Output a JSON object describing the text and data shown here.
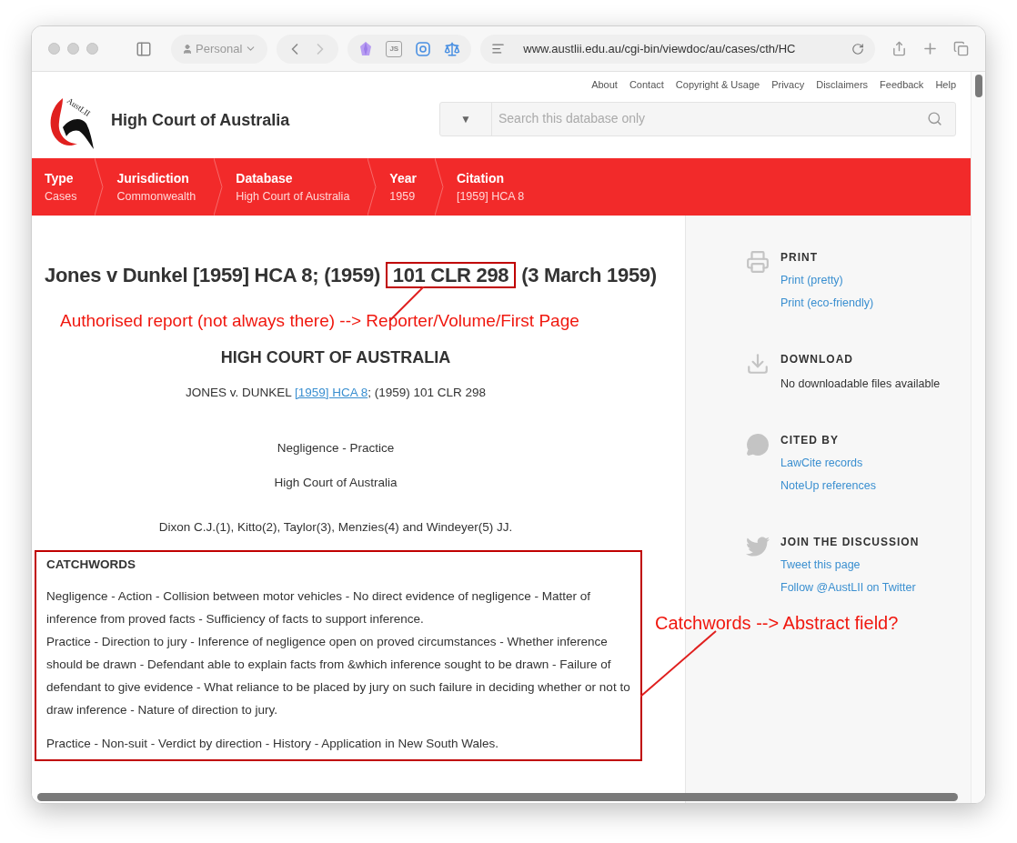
{
  "browser": {
    "profile": "Personal",
    "js_extension": "JS",
    "url": "www.austlii.edu.au/cgi-bin/viewdoc/au/cases/cth/HC"
  },
  "header": {
    "logo_text": "AustLII",
    "site_title": "High Court of Australia",
    "top_links": [
      "About",
      "Contact",
      "Copyright & Usage",
      "Privacy",
      "Disclaimers",
      "Feedback",
      "Help"
    ],
    "search": {
      "scope_arrow": "▼",
      "placeholder": "Search this database only"
    }
  },
  "breadcrumbs": [
    {
      "label": "Type",
      "value": "Cases"
    },
    {
      "label": "Jurisdiction",
      "value": "Commonwealth"
    },
    {
      "label": "Database",
      "value": "High Court of Australia"
    },
    {
      "label": "Year",
      "value": "1959"
    },
    {
      "label": "Citation",
      "value": "[1959] HCA 8"
    }
  ],
  "document": {
    "title": {
      "before": "Jones v Dunkel [1959] HCA 8; (1959)",
      "highlighted": "101 CLR 298",
      "after": "(3 March 1959)"
    },
    "title_annotation": "Authorised report (not always there) --> Reporter/Volume/First Page",
    "court_heading": "HIGH COURT OF AUSTRALIA",
    "citation": {
      "before": "JONES v. DUNKEL ",
      "link": "[1959] HCA 8",
      "after": "; (1959) 101 CLR 298"
    },
    "subject": "Negligence - Practice",
    "court": "High Court of Australia",
    "judges": "Dixon C.J.(1), Kitto(2), Taylor(3), Menzies(4) and Windeyer(5) JJ.",
    "catchwords": {
      "heading": "CATCHWORDS",
      "annotation": "Catchwords --> Abstract field?",
      "paragraphs": [
        {
          "lines": [
            "Negligence - Action - Collision between motor vehicles - No direct evidence of negligence - Matter of inference from proved facts - Sufficiency of facts to support inference.",
            "Practice - Direction to jury - Inference of negligence open on proved circumstances - Whether inference should be drawn - Defendant able to explain facts from &which inference sought to be drawn - Failure of defendant to give evidence - What reliance to be placed by jury on such failure in deciding whether or not to draw inference - Nature of direction to jury."
          ]
        },
        {
          "lines": [
            "Practice - Non-suit - Verdict by direction - History - Application in New South Wales."
          ]
        }
      ]
    }
  },
  "sidebar": [
    {
      "heading": "PRINT",
      "items": [
        {
          "kind": "link",
          "text": "Print (pretty)"
        },
        {
          "kind": "link",
          "text": "Print (eco-friendly)"
        }
      ]
    },
    {
      "heading": "DOWNLOAD",
      "items": [
        {
          "kind": "note",
          "text": "No downloadable files available"
        }
      ]
    },
    {
      "heading": "CITED BY",
      "items": [
        {
          "kind": "link",
          "text": "LawCite records"
        },
        {
          "kind": "link",
          "text": "NoteUp references"
        }
      ]
    },
    {
      "heading": "JOIN THE DISCUSSION",
      "items": [
        {
          "kind": "link",
          "text": "Tweet this page"
        },
        {
          "kind": "link",
          "text": "Follow @AustLII on Twitter"
        }
      ]
    }
  ]
}
